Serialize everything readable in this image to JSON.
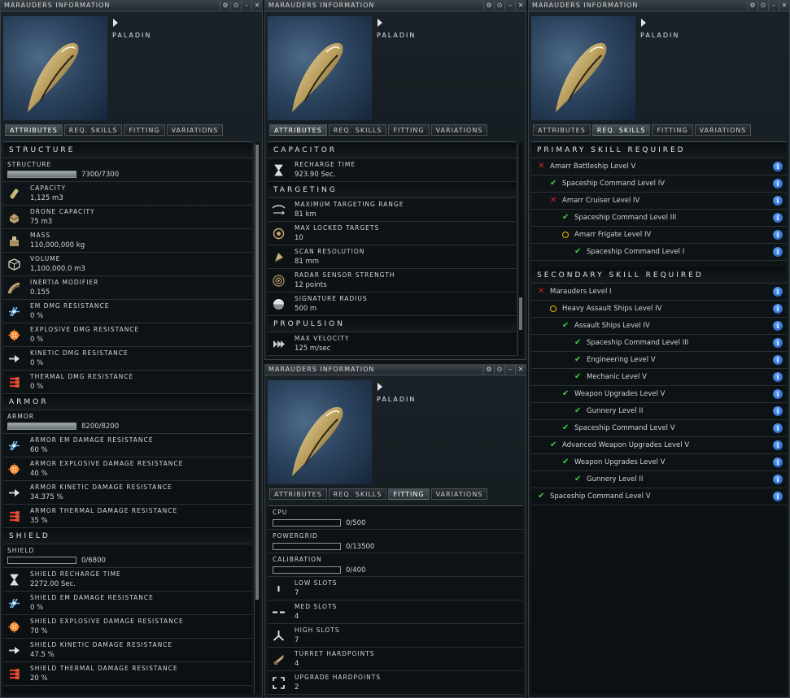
{
  "window_title": "MARAUDERS INFORMATION",
  "ship_name": "PALADIN",
  "title_buttons": [
    "⚙",
    "⊙",
    "–",
    "✕"
  ],
  "tabs": {
    "attributes": "ATTRIBUTES",
    "req_skills": "REQ. SKILLS",
    "fitting": "FITTING",
    "variations": "VARIATIONS"
  },
  "attributes": {
    "structure": {
      "header": "STRUCTURE",
      "hp_label": "STRUCTURE",
      "hp_value": "7300/7300",
      "hp_fraction": 1.0,
      "rows": [
        {
          "icon": "capacity-icon",
          "label": "CAPACITY",
          "value": "1,125 m3"
        },
        {
          "icon": "drone-capacity-icon",
          "label": "DRONE CAPACITY",
          "value": "75 m3"
        },
        {
          "icon": "mass-icon",
          "label": "MASS",
          "value": "110,000,000 kg"
        },
        {
          "icon": "volume-icon",
          "label": "VOLUME",
          "value": "1,100,000.0 m3"
        },
        {
          "icon": "inertia-icon",
          "label": "INERTIA MODIFIER",
          "value": "0.155"
        },
        {
          "icon": "em-resistance-icon",
          "label": "EM DMG RESISTANCE",
          "value": "0 %"
        },
        {
          "icon": "explosive-resistance-icon",
          "label": "EXPLOSIVE DMG RESISTANCE",
          "value": "0 %"
        },
        {
          "icon": "kinetic-resistance-icon",
          "label": "KINETIC DMG RESISTANCE",
          "value": "0 %"
        },
        {
          "icon": "thermal-resistance-icon",
          "label": "THERMAL DMG RESISTANCE",
          "value": "0 %"
        }
      ]
    },
    "armor": {
      "header": "ARMOR",
      "hp_label": "ARMOR",
      "hp_value": "8200/8200",
      "hp_fraction": 1.0,
      "rows": [
        {
          "icon": "em-resistance-icon",
          "label": "ARMOR EM DAMAGE RESISTANCE",
          "value": "60 %"
        },
        {
          "icon": "explosive-resistance-icon",
          "label": "ARMOR EXPLOSIVE DAMAGE RESISTANCE",
          "value": "40 %"
        },
        {
          "icon": "kinetic-resistance-icon",
          "label": "ARMOR KINETIC DAMAGE RESISTANCE",
          "value": "34.375 %"
        },
        {
          "icon": "thermal-resistance-icon",
          "label": "ARMOR THERMAL DAMAGE RESISTANCE",
          "value": "35 %"
        }
      ]
    },
    "shield": {
      "header": "SHIELD",
      "hp_label": "SHIELD",
      "hp_value": "0/6800",
      "hp_fraction": 0.0,
      "rows": [
        {
          "icon": "hourglass-icon",
          "label": "SHIELD RECHARGE TIME",
          "value": "2272.00 Sec."
        },
        {
          "icon": "em-resistance-icon",
          "label": "SHIELD EM DAMAGE RESISTANCE",
          "value": "0 %"
        },
        {
          "icon": "explosive-resistance-icon",
          "label": "SHIELD EXPLOSIVE DAMAGE RESISTANCE",
          "value": "70 %"
        },
        {
          "icon": "kinetic-resistance-icon",
          "label": "SHIELD KINETIC DAMAGE RESISTANCE",
          "value": "47.5 %"
        },
        {
          "icon": "thermal-resistance-icon",
          "label": "SHIELD THERMAL DAMAGE RESISTANCE",
          "value": "20 %"
        }
      ]
    }
  },
  "attributes2": {
    "capacitor": {
      "header": "CAPACITOR",
      "rows": [
        {
          "icon": "hourglass-icon",
          "label": "RECHARGE TIME",
          "value": "923.90 Sec."
        }
      ]
    },
    "targeting": {
      "header": "TARGETING",
      "rows": [
        {
          "icon": "targeting-range-icon",
          "label": "MAXIMUM TARGETING RANGE",
          "value": "81 km"
        },
        {
          "icon": "locked-targets-icon",
          "label": "MAX LOCKED TARGETS",
          "value": "10"
        },
        {
          "icon": "scan-resolution-icon",
          "label": "SCAN RESOLUTION",
          "value": "81 mm"
        },
        {
          "icon": "radar-sensor-icon",
          "label": "RADAR SENSOR STRENGTH",
          "value": "12 points"
        },
        {
          "icon": "signature-radius-icon",
          "label": "SIGNATURE RADIUS",
          "value": "500 m"
        }
      ]
    },
    "propulsion": {
      "header": "PROPULSION",
      "rows": [
        {
          "icon": "velocity-icon",
          "label": "MAX VELOCITY",
          "value": "125 m/sec"
        }
      ]
    }
  },
  "fitting": {
    "cpu": {
      "label": "CPU",
      "value": "0/500"
    },
    "powergrid": {
      "label": "POWERGRID",
      "value": "0/13500"
    },
    "calibration": {
      "label": "CALIBRATION",
      "value": "0/400"
    },
    "rows": [
      {
        "icon": "low-slot-icon",
        "label": "LOW SLOTS",
        "value": "7"
      },
      {
        "icon": "med-slot-icon",
        "label": "MED SLOTS",
        "value": "4"
      },
      {
        "icon": "high-slot-icon",
        "label": "HIGH SLOTS",
        "value": "7"
      },
      {
        "icon": "turret-hardpoint-icon",
        "label": "TURRET HARDPOINTS",
        "value": "4"
      },
      {
        "icon": "upgrade-hardpoint-icon",
        "label": "UPGRADE HARDPOINTS",
        "value": "2"
      }
    ]
  },
  "skills": {
    "primary_header": "PRIMARY SKILL REQUIRED",
    "secondary_header": "SECONDARY SKILL REQUIRED",
    "primary": [
      {
        "status": "missing",
        "depth": 0,
        "name": "Amarr Battleship Level V"
      },
      {
        "status": "ok",
        "depth": 1,
        "name": "Spaceship Command Level IV"
      },
      {
        "status": "missing",
        "depth": 1,
        "name": "Amarr Cruiser Level IV"
      },
      {
        "status": "ok",
        "depth": 2,
        "name": "Spaceship Command Level III"
      },
      {
        "status": "training",
        "depth": 2,
        "name": "Amarr Frigate Level IV"
      },
      {
        "status": "ok",
        "depth": 3,
        "name": "Spaceship Command Level I"
      }
    ],
    "secondary": [
      {
        "status": "missing",
        "depth": 0,
        "name": "Marauders Level I"
      },
      {
        "status": "training",
        "depth": 1,
        "name": "Heavy Assault Ships Level IV"
      },
      {
        "status": "ok",
        "depth": 2,
        "name": "Assault Ships Level IV"
      },
      {
        "status": "ok",
        "depth": 3,
        "name": "Spaceship Command Level III"
      },
      {
        "status": "ok",
        "depth": 3,
        "name": "Engineering Level V"
      },
      {
        "status": "ok",
        "depth": 3,
        "name": "Mechanic Level V"
      },
      {
        "status": "ok",
        "depth": 2,
        "name": "Weapon Upgrades Level V"
      },
      {
        "status": "ok",
        "depth": 3,
        "name": "Gunnery Level II"
      },
      {
        "status": "ok",
        "depth": 2,
        "name": "Spaceship Command Level V"
      },
      {
        "status": "ok",
        "depth": 1,
        "name": "Advanced Weapon Upgrades Level V"
      },
      {
        "status": "ok",
        "depth": 2,
        "name": "Weapon Upgrades Level V"
      },
      {
        "status": "ok",
        "depth": 3,
        "name": "Gunnery Level II"
      },
      {
        "status": "ok",
        "depth": 0,
        "name": "Spaceship Command Level V"
      }
    ]
  }
}
